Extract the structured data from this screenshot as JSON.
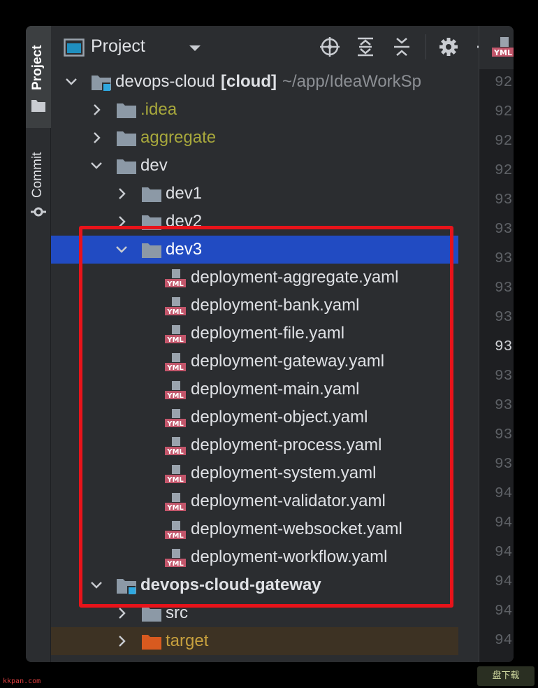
{
  "tool_strip": {
    "project_tab": "Project",
    "commit_tab": "Commit"
  },
  "panel": {
    "title": "Project",
    "dropdown_icon": "chevron-down-icon",
    "header_icons": [
      "locate-icon",
      "expand-all-icon",
      "collapse-all-icon",
      "gear-icon",
      "minimize-icon"
    ]
  },
  "tree": {
    "rows": [
      {
        "indent": 0,
        "expanded": true,
        "icon": "module",
        "label": "devops-cloud",
        "extra": "[cloud]",
        "path": "~/app/IdeaWorkSp",
        "color": "normal"
      },
      {
        "indent": 1,
        "expanded": false,
        "icon": "folder",
        "label": ".idea",
        "color": "olive"
      },
      {
        "indent": 1,
        "expanded": false,
        "icon": "folder",
        "label": "aggregate",
        "color": "olive"
      },
      {
        "indent": 1,
        "expanded": true,
        "icon": "folder",
        "label": "dev",
        "color": "normal"
      },
      {
        "indent": 2,
        "expanded": false,
        "icon": "folder",
        "label": "dev1",
        "color": "normal"
      },
      {
        "indent": 2,
        "expanded": false,
        "icon": "folder",
        "label": "dev2",
        "color": "normal"
      },
      {
        "indent": 2,
        "expanded": true,
        "icon": "folder",
        "label": "dev3",
        "color": "normal",
        "selected": true
      },
      {
        "indent": 3,
        "icon": "yaml",
        "label": "deployment-aggregate.yaml"
      },
      {
        "indent": 3,
        "icon": "yaml",
        "label": "deployment-bank.yaml"
      },
      {
        "indent": 3,
        "icon": "yaml",
        "label": "deployment-file.yaml"
      },
      {
        "indent": 3,
        "icon": "yaml",
        "label": "deployment-gateway.yaml"
      },
      {
        "indent": 3,
        "icon": "yaml",
        "label": "deployment-main.yaml"
      },
      {
        "indent": 3,
        "icon": "yaml",
        "label": "deployment-object.yaml"
      },
      {
        "indent": 3,
        "icon": "yaml",
        "label": "deployment-process.yaml"
      },
      {
        "indent": 3,
        "icon": "yaml",
        "label": "deployment-system.yaml"
      },
      {
        "indent": 3,
        "icon": "yaml",
        "label": "deployment-validator.yaml"
      },
      {
        "indent": 3,
        "icon": "yaml",
        "label": "deployment-websocket.yaml"
      },
      {
        "indent": 3,
        "icon": "yaml",
        "label": "deployment-workflow.yaml"
      },
      {
        "indent": 1,
        "expanded": true,
        "icon": "module",
        "label": "devops-cloud-gateway",
        "color": "normal",
        "bold": true
      },
      {
        "indent": 2,
        "expanded": false,
        "icon": "folder",
        "label": "src",
        "color": "normal"
      },
      {
        "indent": 2,
        "expanded": false,
        "icon": "folder-orange",
        "label": "target",
        "color": "orange",
        "excluded": true
      }
    ]
  },
  "gutter": {
    "tab_icon_label": "YML",
    "line_numbers": [
      "92",
      "92",
      "92",
      "92",
      "93",
      "93",
      "93",
      "93",
      "93",
      "93",
      "93",
      "93",
      "93",
      "93",
      "94",
      "94",
      "94",
      "94",
      "94",
      "94",
      "94"
    ],
    "current_index": 9
  },
  "yaml_icon_label": "YML",
  "watermark": {
    "left": "kkpan.com",
    "right": "盘下载"
  },
  "colors": {
    "selection": "#214bc2",
    "highlight_box": "#e8131a",
    "folder": "#8c99a6",
    "yaml_badge": "#c2566b",
    "module_badge": "#2fa8e0"
  }
}
